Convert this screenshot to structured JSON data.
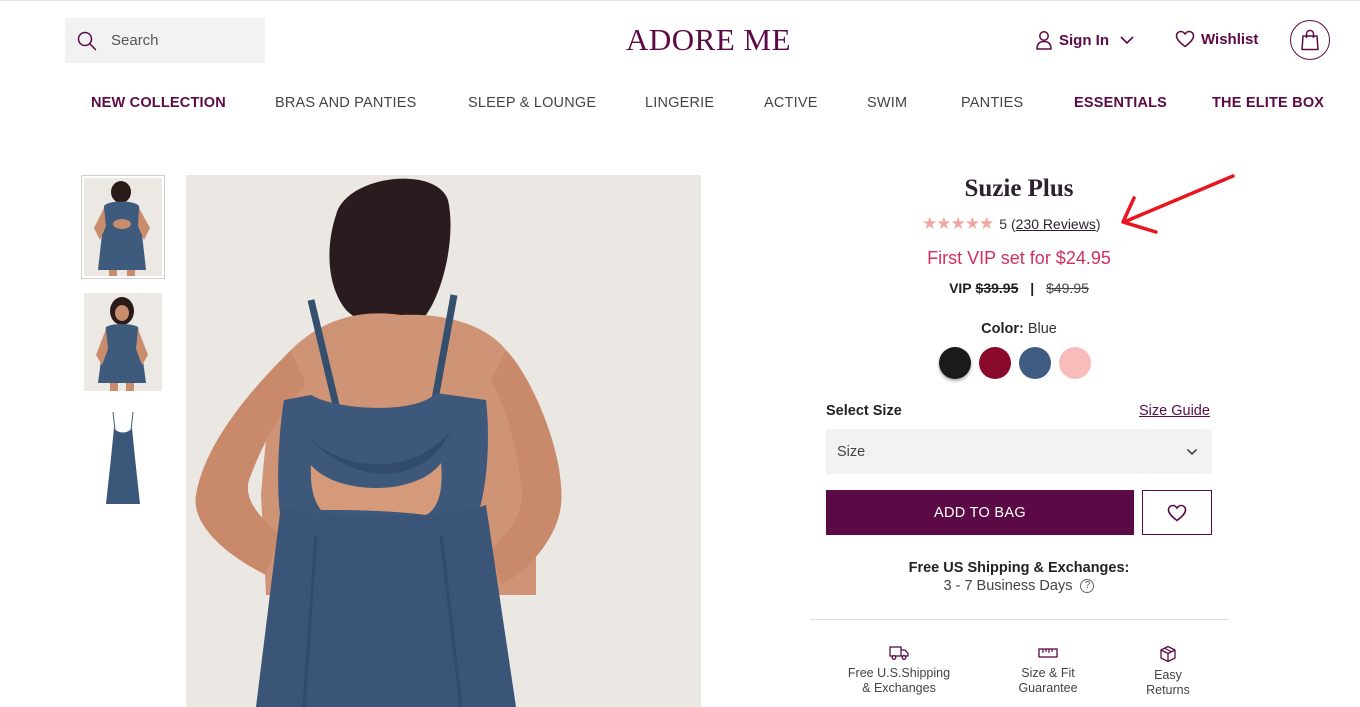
{
  "header": {
    "search_placeholder": "Search",
    "logo": "ADORE ME",
    "sign_in": "Sign In",
    "wishlist": "Wishlist"
  },
  "nav": [
    {
      "label": "NEW COLLECTION",
      "accent": true
    },
    {
      "label": "BRAS AND PANTIES",
      "accent": false
    },
    {
      "label": "SLEEP & LOUNGE",
      "accent": false
    },
    {
      "label": "LINGERIE",
      "accent": false
    },
    {
      "label": "ACTIVE",
      "accent": false
    },
    {
      "label": "SWIM",
      "accent": false
    },
    {
      "label": "PANTIES",
      "accent": false
    },
    {
      "label": "ESSENTIALS",
      "accent": true
    },
    {
      "label": "THE ELITE BOX",
      "accent": true
    }
  ],
  "product": {
    "name": "Suzie Plus",
    "rating_value": "5",
    "rating_stars": 5,
    "reviews_open": "(",
    "reviews_link": "230 Reviews",
    "reviews_close": ")",
    "promo": "First VIP set for $24.95",
    "vip_label": "VIP",
    "vip_price": "$39.95",
    "separator": "|",
    "regular_price": "$49.95",
    "color_label": "Color:",
    "color_value": "Blue",
    "swatches": [
      {
        "name": "black",
        "hex": "#1a1a1a",
        "selected": false
      },
      {
        "name": "red",
        "hex": "#8a0a2c",
        "selected": false
      },
      {
        "name": "blue",
        "hex": "#3f5b82",
        "selected": true
      },
      {
        "name": "pink",
        "hex": "#f8bdbb",
        "selected": false
      }
    ],
    "select_size_label": "Select Size",
    "size_guide": "Size Guide",
    "size_placeholder": "Size",
    "add_to_bag": "ADD TO BAG",
    "shipping_title": "Free US Shipping & Exchanges:",
    "shipping_days": "3 - 7 Business Days",
    "help_glyph": "?"
  },
  "features": [
    {
      "icon": "truck-icon",
      "line1": "Free U.S.Shipping",
      "line2": "& Exchanges"
    },
    {
      "icon": "ruler-icon",
      "line1": "Size & Fit",
      "line2": "Guarantee"
    },
    {
      "icon": "box-icon",
      "line1": "Easy",
      "line2": "Returns"
    }
  ],
  "thumbnails": [
    {
      "view": "back",
      "selected": true
    },
    {
      "view": "front",
      "selected": false
    },
    {
      "view": "flat",
      "selected": false
    }
  ],
  "colors": {
    "brand": "#5c0a45",
    "promo": "#d12f5f",
    "stars": "#f0a7a0",
    "annotation_arrow": "#e8141e"
  }
}
